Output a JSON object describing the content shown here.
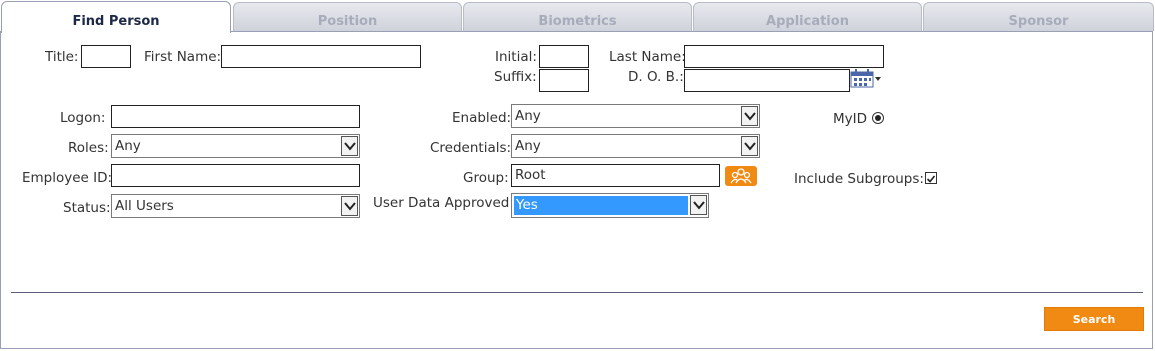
{
  "tabs": [
    {
      "label": "Find Person",
      "active": true
    },
    {
      "label": "Position",
      "active": false
    },
    {
      "label": "Biometrics",
      "active": false
    },
    {
      "label": "Application",
      "active": false
    },
    {
      "label": "Sponsor",
      "active": false
    }
  ],
  "form": {
    "title": {
      "label": "Title:",
      "value": ""
    },
    "first_name": {
      "label": "First Name:",
      "value": ""
    },
    "initial": {
      "label": "Initial:",
      "value": ""
    },
    "last_name": {
      "label": "Last Name:",
      "value": ""
    },
    "suffix": {
      "label": "Suffix:",
      "value": ""
    },
    "dob": {
      "label": "D. O. B.:",
      "value": ""
    },
    "logon": {
      "label": "Logon:",
      "value": ""
    },
    "enabled": {
      "label": "Enabled:",
      "value": "Any"
    },
    "myid": {
      "label": "MyID",
      "selected": true
    },
    "roles": {
      "label": "Roles:",
      "value": "Any"
    },
    "credentials": {
      "label": "Credentials:",
      "value": "Any"
    },
    "employee_id": {
      "label": "Employee ID:",
      "value": ""
    },
    "group": {
      "label": "Group:",
      "value": "Root"
    },
    "include_subgroups": {
      "label": "Include Subgroups:",
      "checked": true
    },
    "status": {
      "label": "Status:",
      "value": "All Users"
    },
    "user_data_approved": {
      "label": "User Data Approved:",
      "value": "Yes"
    }
  },
  "actions": {
    "search_label": "Search"
  },
  "colors": {
    "accent": "#f08a12",
    "selection": "#3399ff",
    "active_tab_text": "#1d2a45"
  }
}
